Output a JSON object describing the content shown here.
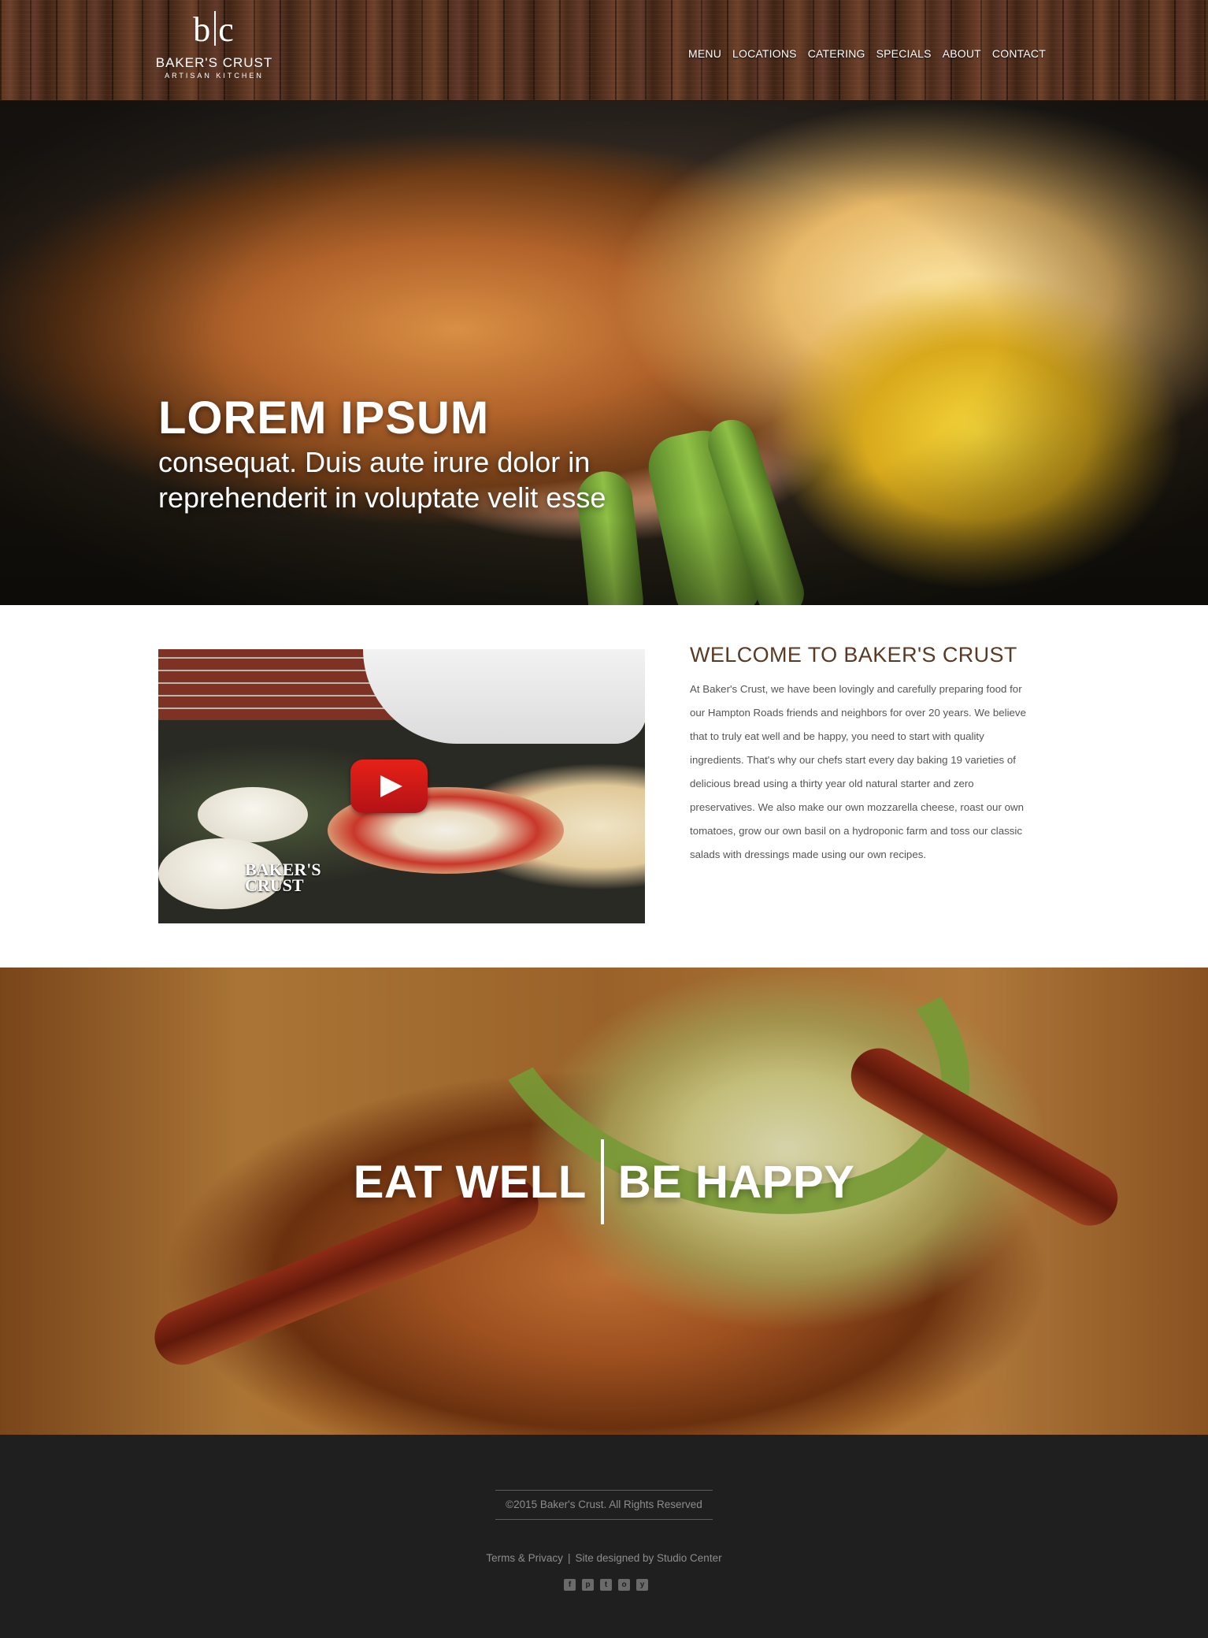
{
  "brand": {
    "mark": "b|c",
    "mark_left": "b",
    "mark_right": "c",
    "name": "BAKER'S CRUST",
    "subtitle": "ARTISAN KITCHEN"
  },
  "nav": {
    "items": [
      "MENU",
      "LOCATIONS",
      "CATERING",
      "SPECIALS",
      "ABOUT",
      "CONTACT"
    ]
  },
  "hero": {
    "title": "LOREM IPSUM",
    "subtitle": "consequat. Duis aute irure dolor in reprehenderit in voluptate velit esse"
  },
  "welcome": {
    "title": "WELCOME TO BAKER'S CRUST",
    "body": "At Baker's Crust, we have been lovingly and carefully preparing food for our Hampton Roads friends and neighbors for over 20 years. We believe that to truly eat well and be happy, you need to start with quality ingredients. That's why our chefs start every day baking 19 varieties of delicious bread using a thirty year old natural starter and zero preservatives. We also make our own mozzarella cheese, roast our own tomatoes, grow our own basil on a hydroponic farm and toss our classic salads with dressings made using our own recipes.",
    "video_watermark_line1": "BAKER'S",
    "video_watermark_line2": "CRUST"
  },
  "banner": {
    "left": "EAT WELL",
    "right": "BE HAPPY"
  },
  "footer": {
    "copyright": "©2015 Baker's Crust. All Rights Reserved",
    "terms": "Terms & Privacy",
    "separator": "|",
    "credit": "Site designed by Studio Center",
    "social_icons": [
      "facebook-icon",
      "pinterest-icon",
      "twitter-icon",
      "instagram-icon",
      "youtube-icon"
    ],
    "social_glyphs": [
      "f",
      "p",
      "t",
      "o",
      "y"
    ]
  },
  "colors": {
    "heading_brown": "#5a3a22",
    "footer_bg": "#1f1f1f",
    "footer_text": "#8d8d8d",
    "play_red": "#e62117"
  }
}
